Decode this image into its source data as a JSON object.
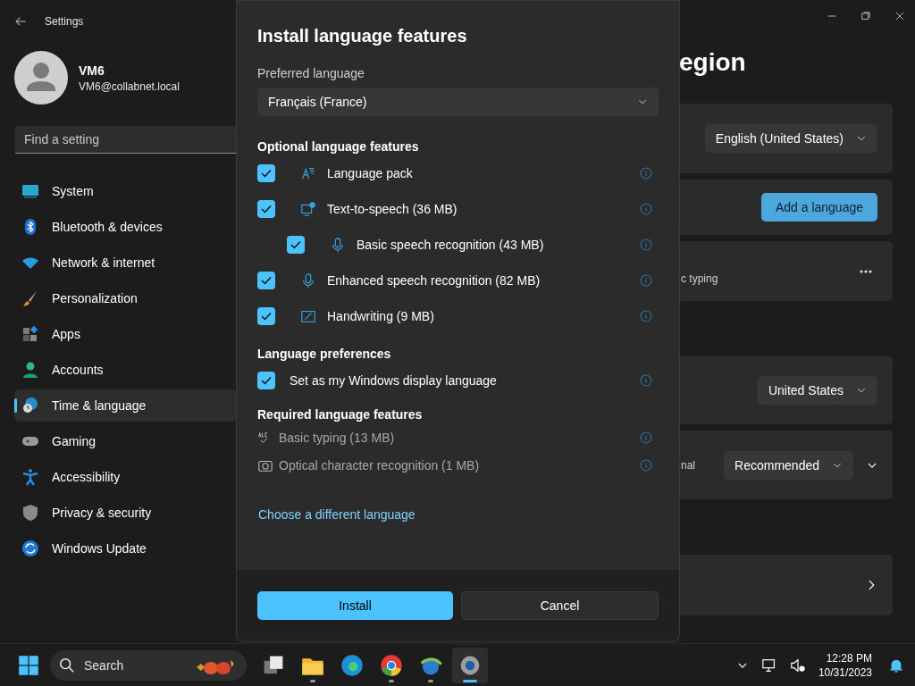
{
  "window": {
    "title": "Settings"
  },
  "user": {
    "name": "VM6",
    "email": "VM6@collabnet.local"
  },
  "search": {
    "placeholder": "Find a setting"
  },
  "nav": [
    {
      "label": "System",
      "kind": "system",
      "selected": false
    },
    {
      "label": "Bluetooth & devices",
      "kind": "bluetooth",
      "selected": false
    },
    {
      "label": "Network & internet",
      "kind": "wifi",
      "selected": false
    },
    {
      "label": "Personalization",
      "kind": "brush",
      "selected": false
    },
    {
      "label": "Apps",
      "kind": "apps",
      "selected": false
    },
    {
      "label": "Accounts",
      "kind": "person",
      "selected": false
    },
    {
      "label": "Time & language",
      "kind": "clock",
      "selected": true
    },
    {
      "label": "Gaming",
      "kind": "gamepad",
      "selected": false
    },
    {
      "label": "Accessibility",
      "kind": "accessibility",
      "selected": false
    },
    {
      "label": "Privacy & security",
      "kind": "shield",
      "selected": false
    },
    {
      "label": "Windows Update",
      "kind": "update",
      "selected": false
    }
  ],
  "page": {
    "title": "egion",
    "cards": [
      {
        "kind": "dropdown",
        "value": "English (United States)"
      },
      {
        "kind": "button",
        "label": "Add a language"
      },
      {
        "kind": "more",
        "text": "c typing"
      },
      {
        "kind": "gap"
      },
      {
        "kind": "dropdown",
        "value": "United States"
      },
      {
        "kind": "expander",
        "text": "nal",
        "value": "Recommended"
      },
      {
        "kind": "gap"
      },
      {
        "kind": "link"
      }
    ]
  },
  "dialog": {
    "title": "Install language features",
    "preferred": {
      "label": "Preferred language",
      "value": "Français (France)"
    },
    "optional": {
      "heading": "Optional language features",
      "items": [
        {
          "label": "Language pack",
          "kind": "pack",
          "checked": true
        },
        {
          "label": "Text-to-speech (36 MB)",
          "kind": "tts",
          "checked": true,
          "children": [
            {
              "label": "Basic speech recognition (43 MB)",
              "kind": "mic",
              "checked": true
            }
          ]
        },
        {
          "label": "Enhanced speech recognition (82 MB)",
          "kind": "mic",
          "checked": true
        },
        {
          "label": "Handwriting (9 MB)",
          "kind": "pen",
          "checked": true
        }
      ]
    },
    "preferences": {
      "heading": "Language preferences",
      "items": [
        {
          "label": "Set as my Windows display language",
          "checked": true
        }
      ]
    },
    "required": {
      "heading": "Required language features",
      "items": [
        {
          "label": "Basic typing (13 MB)",
          "kind": "abc"
        },
        {
          "label": "Optical character recognition (1 MB)",
          "kind": "camera"
        }
      ]
    },
    "link": "Choose a different language",
    "buttons": [
      {
        "label": "Install",
        "kind": "primary"
      },
      {
        "label": "Cancel",
        "kind": "secondary"
      }
    ]
  },
  "taskbar": {
    "search": "Search",
    "apps": [
      {
        "kind": "taskview",
        "running": false,
        "selected": false
      },
      {
        "kind": "folder",
        "running": true,
        "selected": false
      },
      {
        "kind": "edge",
        "running": false,
        "selected": false
      },
      {
        "kind": "chrome",
        "running": true,
        "selected": false
      },
      {
        "kind": "globe",
        "running": true,
        "selected": false
      },
      {
        "kind": "gear",
        "running": true,
        "selected": true
      }
    ],
    "time": "12:28 PM",
    "date": "10/31/2023"
  }
}
